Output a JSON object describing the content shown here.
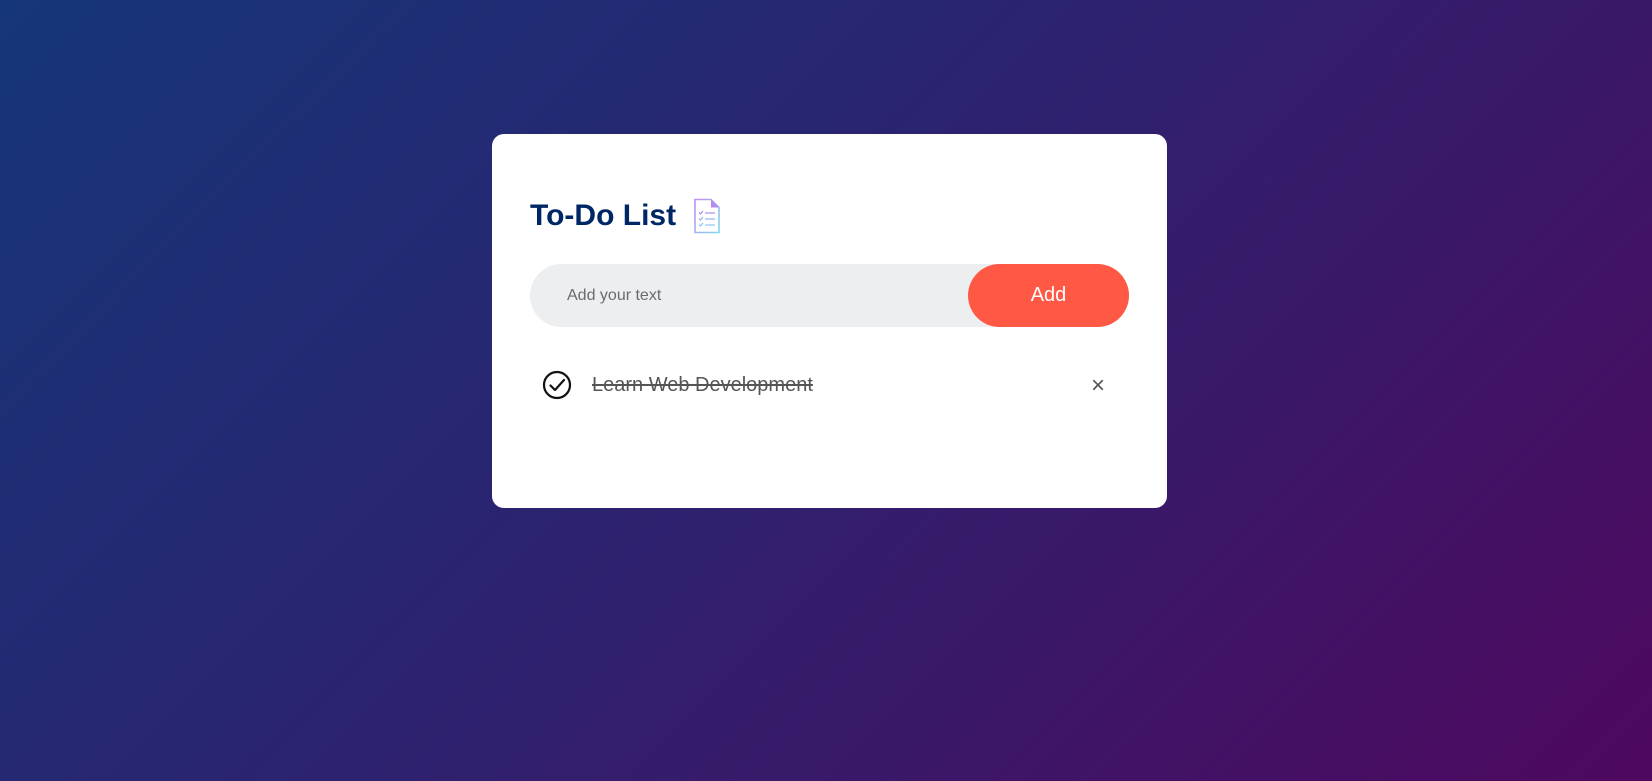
{
  "app": {
    "title": "To-Do List",
    "title_icon": "notepad-checklist-icon"
  },
  "input": {
    "placeholder": "Add your text",
    "value": ""
  },
  "add_button": {
    "label": "Add"
  },
  "tasks": [
    {
      "text": "Learn Web Development",
      "checked": true,
      "check_icon": "checked-circle-icon",
      "delete_label": "×",
      "delete_icon": "close-icon"
    }
  ],
  "colors": {
    "accent": "#ff5945",
    "title": "#002765",
    "input_bg": "#edeef0",
    "bg_start": "#153677",
    "bg_end": "#4e085f"
  }
}
